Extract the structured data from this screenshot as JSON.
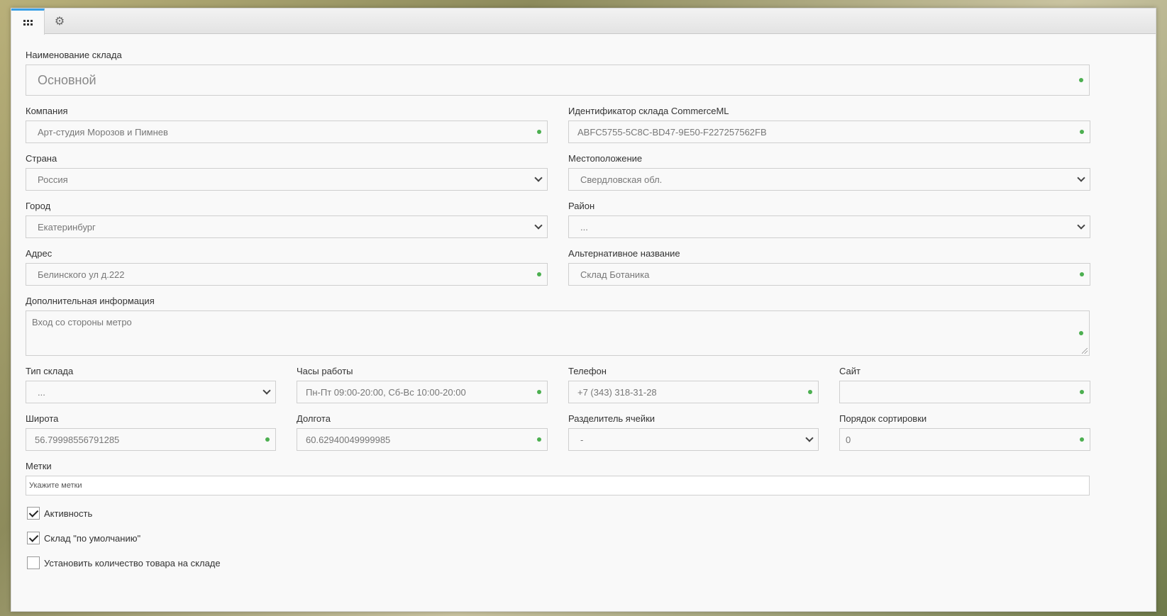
{
  "tabs": [
    {
      "icon": "grid-icon",
      "active": true
    },
    {
      "icon": "gear-icon",
      "active": false
    }
  ],
  "fields": {
    "warehouse_name": {
      "label": "Наименование склада",
      "value": "Основной"
    },
    "company": {
      "label": "Компания",
      "value": "Арт-студия Морозов и Пимнев"
    },
    "commerceml_id": {
      "label": "Идентификатор склада CommerceML",
      "value": "ABFC5755-5C8C-BD47-9E50-F227257562FB"
    },
    "country": {
      "label": "Страна",
      "value": "Россия"
    },
    "location": {
      "label": "Местоположение",
      "value": "Свердловская обл."
    },
    "city": {
      "label": "Город",
      "value": "Екатеринбург"
    },
    "district": {
      "label": "Район",
      "value": "..."
    },
    "address": {
      "label": "Адрес",
      "value": "Белинского ул д.222"
    },
    "alt_name": {
      "label": "Альтернативное название",
      "value": "Склад Ботаника"
    },
    "extra_info": {
      "label": "Дополнительная информация",
      "value": "Вход со стороны метро"
    },
    "warehouse_type": {
      "label": "Тип склада",
      "value": "..."
    },
    "hours": {
      "label": "Часы работы",
      "value": "Пн-Пт 09:00-20:00, Сб-Вс 10:00-20:00"
    },
    "phone": {
      "label": "Телефон",
      "value": "+7 (343) 318-31-28"
    },
    "site": {
      "label": "Сайт",
      "value": ""
    },
    "latitude": {
      "label": "Широта",
      "value": "56.79998556791285"
    },
    "longitude": {
      "label": "Долгота",
      "value": "60.62940049999985"
    },
    "cell_separator": {
      "label": "Разделитель ячейки",
      "value": "-"
    },
    "sort_order": {
      "label": "Порядок сортировки",
      "value": "0"
    },
    "tags": {
      "label": "Метки",
      "placeholder": "Укажите метки"
    }
  },
  "checkboxes": {
    "active": {
      "label": "Активность",
      "checked": true
    },
    "default": {
      "label": "Склад \"по умолчанию\"",
      "checked": true
    },
    "set_quantity": {
      "label": "Установить количество товара на складе",
      "checked": false
    }
  },
  "colors": {
    "accent": "#3aa0e6",
    "status_dot": "#4caf50"
  }
}
